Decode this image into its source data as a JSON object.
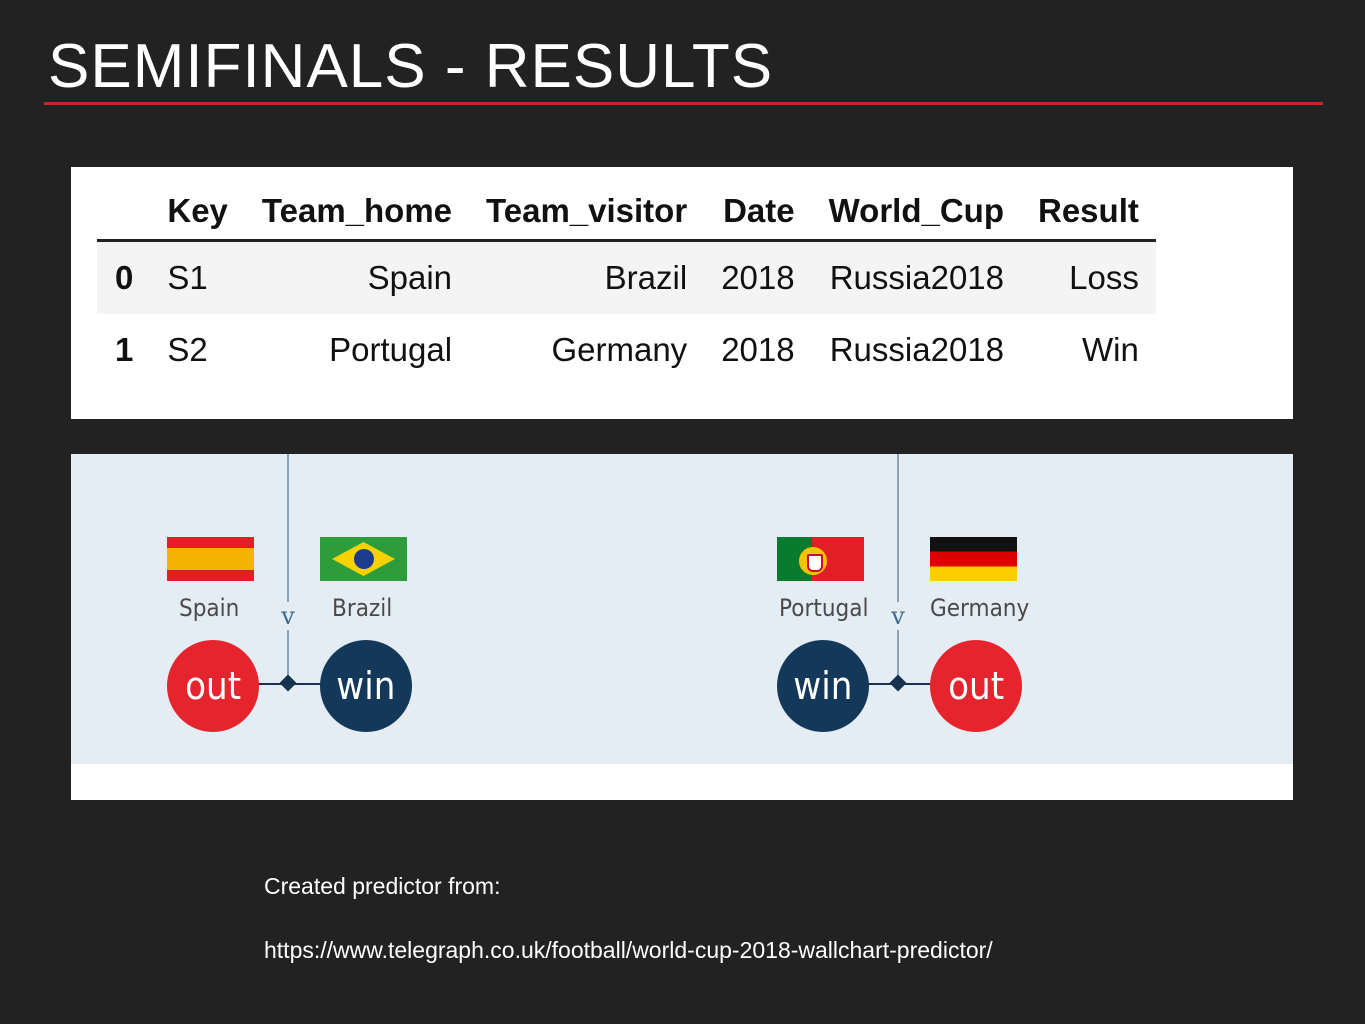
{
  "slide": {
    "title": "SEMIFINALS - RESULTS",
    "accent_color": "#c0282e",
    "background_color": "#222222"
  },
  "results_table": {
    "index_header": "",
    "columns": [
      "Key",
      "Team_home",
      "Team_visitor",
      "Date",
      "World_Cup",
      "Result"
    ],
    "rows": [
      {
        "index": "0",
        "Key": "S1",
        "Team_home": "Spain",
        "Team_visitor": "Brazil",
        "Date": "2018",
        "World_Cup": "Russia2018",
        "Result": "Loss"
      },
      {
        "index": "1",
        "Key": "S2",
        "Team_home": "Portugal",
        "Team_visitor": "Germany",
        "Date": "2018",
        "World_Cup": "Russia2018",
        "Result": "Win"
      }
    ]
  },
  "bracket": {
    "vs_label": "v",
    "matches": [
      {
        "home": {
          "name": "Spain",
          "flag": "spain-flag",
          "outcome": "out"
        },
        "away": {
          "name": "Brazil",
          "flag": "brazil-flag",
          "outcome": "win"
        }
      },
      {
        "home": {
          "name": "Portugal",
          "flag": "portugal-flag",
          "outcome": "win"
        },
        "away": {
          "name": "Germany",
          "flag": "germany-flag",
          "outcome": "out"
        }
      }
    ],
    "colors": {
      "out": "#e5242d",
      "win": "#13385a",
      "panel": "#e4ecf4"
    }
  },
  "footer": {
    "caption": "Created predictor from:",
    "url": "https://www.telegraph.co.uk/football/world-cup-2018-wallchart-predictor/"
  }
}
